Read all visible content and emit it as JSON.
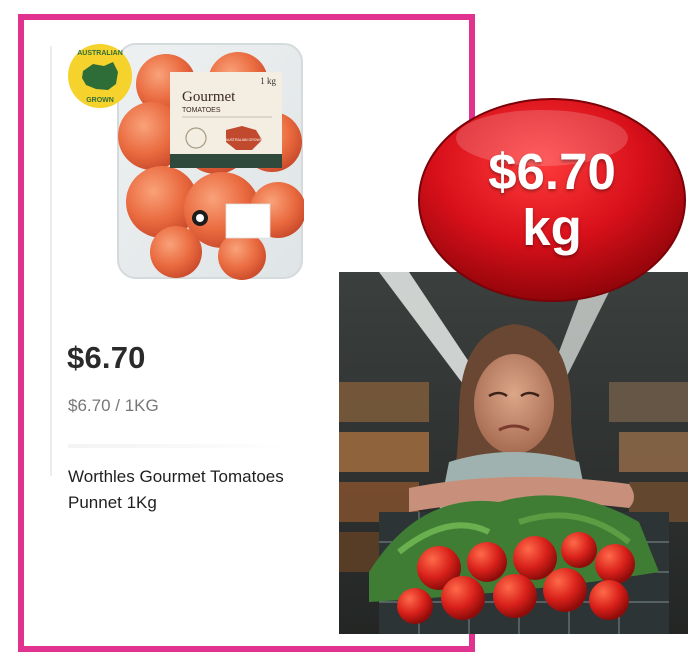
{
  "product": {
    "price": "$6.70",
    "unit_price": "$6.70 / 1KG",
    "name": "Worthles Gourmet Tomatoes Punnet 1Kg",
    "badge": {
      "line1": "AUSTRALIAN",
      "line2": "GROWN"
    },
    "label": {
      "weight": "1 kg",
      "brand": "Gourmet",
      "variety": "TOMATOES",
      "sticker": "AUSTRALIAN GROWN"
    }
  },
  "callout": {
    "price": "$6.70",
    "unit": "kg"
  },
  "colors": {
    "card_border": "#e0328e",
    "bubble_red": "#d8101a",
    "badge_yellow": "#f6d22c"
  }
}
